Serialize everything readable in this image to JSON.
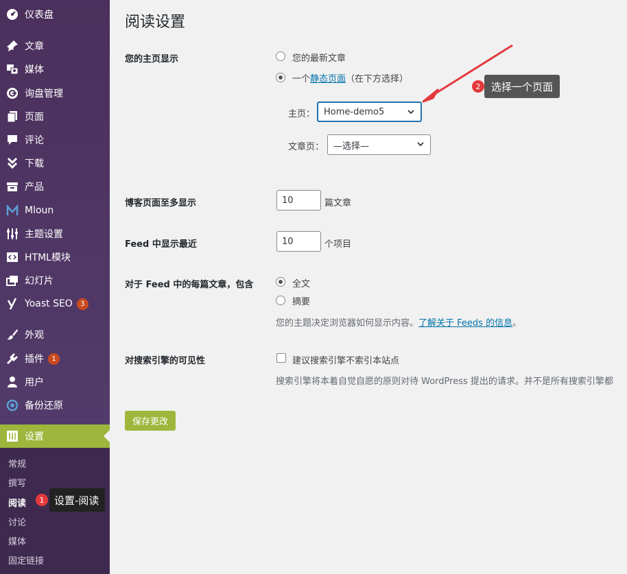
{
  "sidebar": {
    "items": [
      {
        "icon": "dashboard-icon",
        "label": "仪表盘"
      },
      {
        "icon": "pin-icon",
        "label": "文章"
      },
      {
        "icon": "media-icon",
        "label": "媒体"
      },
      {
        "icon": "inquiry-icon",
        "label": "询盘管理"
      },
      {
        "icon": "page-icon",
        "label": "页面"
      },
      {
        "icon": "comment-icon",
        "label": "评论"
      },
      {
        "icon": "download-icon",
        "label": "下载"
      },
      {
        "icon": "product-icon",
        "label": "产品"
      },
      {
        "icon": "mloun-icon",
        "label": "Mloun"
      },
      {
        "icon": "sliders-icon",
        "label": "主题设置"
      },
      {
        "icon": "code-icon",
        "label": "HTML模块"
      },
      {
        "icon": "slides-icon",
        "label": "幻灯片"
      },
      {
        "icon": "yoast-icon",
        "label": "Yoast SEO",
        "badge": "3"
      },
      {
        "icon": "brush-icon",
        "label": "外观"
      },
      {
        "icon": "plugin-icon",
        "label": "插件",
        "badge": "1"
      },
      {
        "icon": "user-icon",
        "label": "用户"
      },
      {
        "icon": "backup-icon",
        "label": "备份还原"
      },
      {
        "icon": "settings-icon",
        "label": "设置"
      }
    ],
    "submenu": [
      "常规",
      "撰写",
      "阅读",
      "讨论",
      "媒体",
      "固定链接"
    ],
    "active_color": "#9eb63c"
  },
  "page": {
    "title": "阅读设置",
    "homepage_label": "您的主页显示",
    "latest_posts": "您的最新文章",
    "static_prefix": "一个",
    "static_link": "静态页面",
    "static_suffix": "（在下方选择）",
    "homepage_select_label": "主页：",
    "homepage_select_value": "Home-demo5",
    "posts_select_label": "文章页：",
    "posts_select_value": "—选择—",
    "blog_pages_label": "博客页面至多显示",
    "blog_pages_value": "10",
    "blog_pages_unit": "篇文章",
    "feed_label": "Feed 中显示最近",
    "feed_value": "10",
    "feed_unit": "个项目",
    "feed_article_label": "对于 Feed 中的每篇文章，包含",
    "full_text": "全文",
    "summary": "摘要",
    "feed_desc": "您的主题决定浏览器如何显示内容。",
    "feed_desc_link": "了解关于 Feeds 的信息",
    "feed_desc_end": "。",
    "visibility_label": "对搜索引擎的可见性",
    "visibility_checkbox": "建议搜索引擎不索引本站点",
    "visibility_desc": "搜索引擎将本着自觉自愿的原则对待 WordPress 提出的请求。并不是所有搜索引擎都",
    "save_button": "保存更改"
  },
  "annotations": {
    "tip1_num": "1",
    "tip1_text": "设置-阅读",
    "tip2_num": "2",
    "tip2_text": "选择一个页面",
    "arrow_color": "#e4393c"
  }
}
